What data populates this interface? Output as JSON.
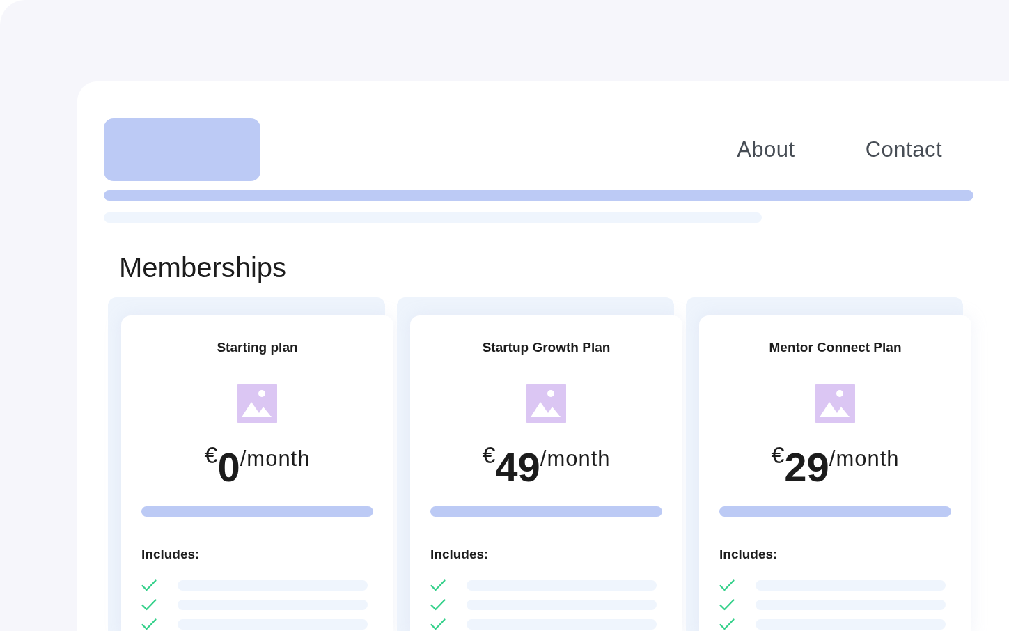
{
  "nav": [
    {
      "label": "About"
    },
    {
      "label": "Contact"
    }
  ],
  "heading": "Memberships",
  "plans": [
    {
      "title": "Starting plan",
      "currency": "€",
      "amount": "0",
      "period": "/month",
      "includes": "Includes:"
    },
    {
      "title": "Startup Growth Plan",
      "currency": "€",
      "amount": "49",
      "period": "/month",
      "includes": "Includes:"
    },
    {
      "title": "Mentor Connect Plan",
      "currency": "€",
      "amount": "29",
      "period": "/month",
      "includes": "Includes:"
    }
  ]
}
